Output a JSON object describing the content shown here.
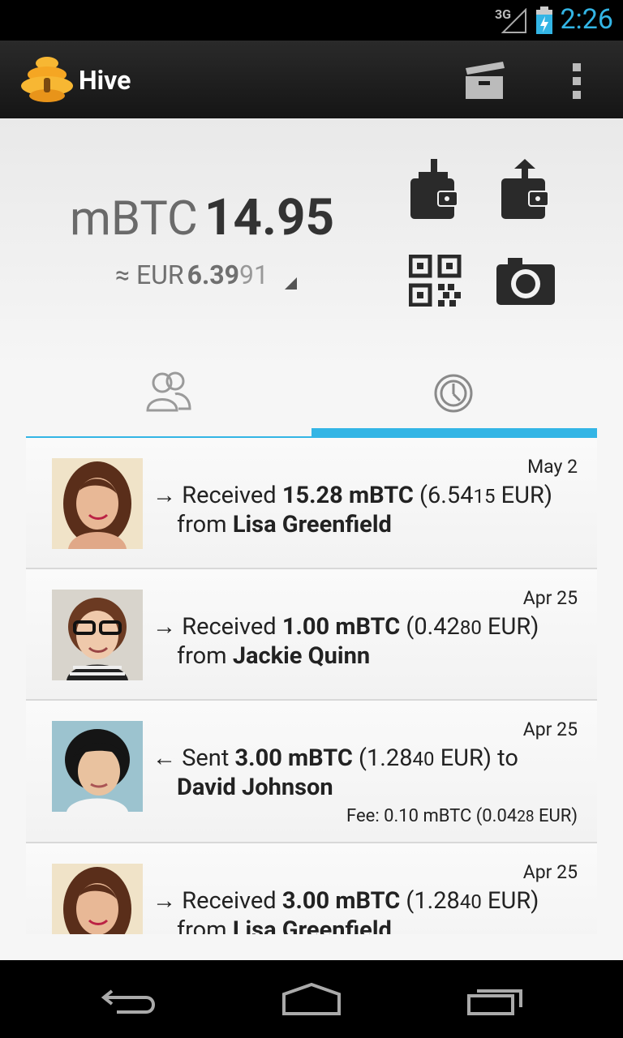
{
  "status_bar": {
    "network": "3G",
    "time": "2:26"
  },
  "action_bar": {
    "title": "Hive",
    "icons": [
      "hive-logo-icon",
      "archive-icon",
      "overflow-menu-icon"
    ]
  },
  "balance": {
    "unit": "mBTC",
    "amount": "14.95",
    "fiat_prefix": "≈ EUR",
    "fiat_main": "6.39",
    "fiat_small": "91"
  },
  "actions": [
    "wallet-receive-icon",
    "wallet-send-icon",
    "qr-code-icon",
    "camera-icon"
  ],
  "tabs": [
    {
      "icon": "contacts-icon",
      "selected": false
    },
    {
      "icon": "history-clock-icon",
      "selected": true
    }
  ],
  "transactions": [
    {
      "date": "May 2",
      "arrow": "→",
      "verb": "Received",
      "amount": "15.28 mBTC",
      "fiat_open": "(6.54",
      "fiat_small": "15",
      "fiat_close": " EUR)",
      "preposition": "from",
      "name": "Lisa Greenfield",
      "fee": ""
    },
    {
      "date": "Apr 25",
      "arrow": "→",
      "verb": "Received",
      "amount": "1.00 mBTC",
      "fiat_open": "(0.42",
      "fiat_small": "80",
      "fiat_close": " EUR)",
      "preposition": "from",
      "name": "Jackie Quinn",
      "fee": ""
    },
    {
      "date": "Apr 25",
      "arrow": "←",
      "verb": "Sent",
      "amount": "3.00 mBTC",
      "fiat_open": "(1.28",
      "fiat_small": "40",
      "fiat_close": " EUR) to",
      "preposition": "",
      "name": "David Johnson",
      "fee_main": "Fee: 0.10 mBTC (0.04",
      "fee_small": "28",
      "fee_close": " EUR)"
    },
    {
      "date": "Apr 25",
      "arrow": "→",
      "verb": "Received",
      "amount": "3.00 mBTC",
      "fiat_open": "(1.28",
      "fiat_small": "40",
      "fiat_close": " EUR)",
      "preposition": "from",
      "name": "Lisa Greenfield",
      "fee": ""
    }
  ],
  "colors": {
    "accent": "#33b5e5",
    "actionbar": "#1e1e1e"
  }
}
